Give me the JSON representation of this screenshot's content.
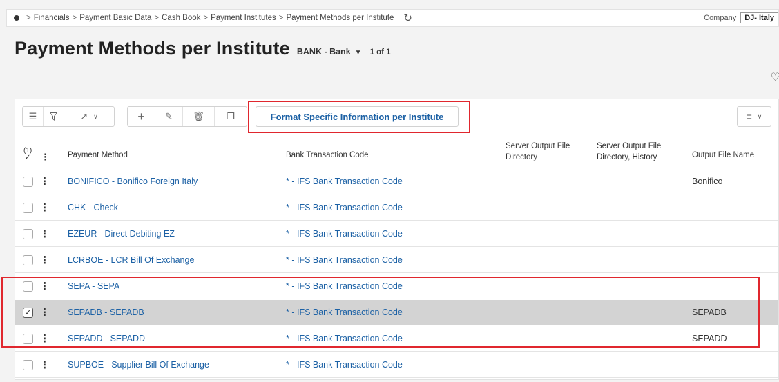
{
  "breadcrumb": {
    "items": [
      "Financials",
      "Payment Basic Data",
      "Cash Book",
      "Payment Institutes",
      "Payment Methods per Institute"
    ],
    "separator": ">",
    "company_label": "Company",
    "company_value": "DJ- Italy"
  },
  "page": {
    "title": "Payment Methods per Institute",
    "record": "BANK - Bank",
    "record_count": "1 of 1"
  },
  "toolbar": {
    "format_button_label": "Format Specific Information per Institute"
  },
  "table": {
    "selected_count": "(1)",
    "columns": {
      "payment_method": "Payment Method",
      "bank_transaction_code": "Bank Transaction Code",
      "server_output_dir": "Server Output File Directory",
      "server_output_dir_history": "Server Output File Directory, History",
      "output_file_name": "Output File Name"
    },
    "rows": [
      {
        "payment_method": "BONIFICO - Bonifico Foreign Italy",
        "bank_transaction_code": "* - IFS Bank Transaction Code",
        "output_file_name": "Bonifico",
        "selected": false
      },
      {
        "payment_method": "CHK - Check",
        "bank_transaction_code": "* - IFS Bank Transaction Code",
        "output_file_name": "",
        "selected": false
      },
      {
        "payment_method": "EZEUR - Direct Debiting EZ",
        "bank_transaction_code": "* - IFS Bank Transaction Code",
        "output_file_name": "",
        "selected": false
      },
      {
        "payment_method": "LCRBOE - LCR Bill Of Exchange",
        "bank_transaction_code": "* - IFS Bank Transaction Code",
        "output_file_name": "",
        "selected": false
      },
      {
        "payment_method": "SEPA - SEPA",
        "bank_transaction_code": "* - IFS Bank Transaction Code",
        "output_file_name": "",
        "selected": false
      },
      {
        "payment_method": "SEPADB - SEPADB",
        "bank_transaction_code": "* - IFS Bank Transaction Code",
        "output_file_name": "SEPADB",
        "selected": true
      },
      {
        "payment_method": "SEPADD - SEPADD",
        "bank_transaction_code": "* - IFS Bank Transaction Code",
        "output_file_name": "SEPADD",
        "selected": false
      },
      {
        "payment_method": "SUPBOE - Supplier Bill Of Exchange",
        "bank_transaction_code": "* - IFS Bank Transaction Code",
        "output_file_name": "",
        "selected": false
      }
    ]
  },
  "colors": {
    "link": "#1c61a5",
    "highlight_box": "#e0272e",
    "selected_row": "#d3d3d3"
  }
}
